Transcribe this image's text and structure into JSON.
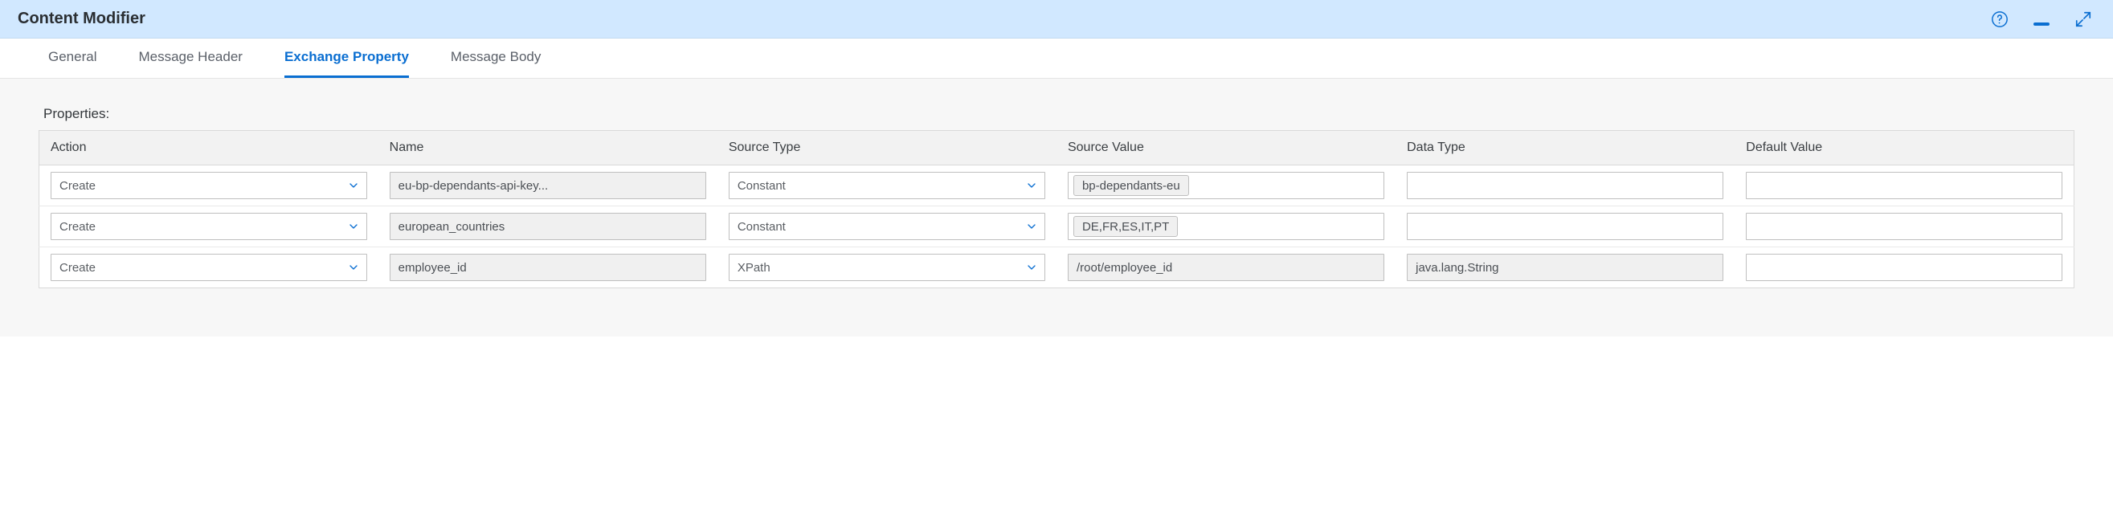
{
  "header": {
    "title": "Content Modifier"
  },
  "tabs": [
    {
      "label": "General",
      "active": false
    },
    {
      "label": "Message Header",
      "active": false
    },
    {
      "label": "Exchange Property",
      "active": true
    },
    {
      "label": "Message Body",
      "active": false
    }
  ],
  "section_label": "Properties:",
  "columns": {
    "action": "Action",
    "name": "Name",
    "source_type": "Source Type",
    "source_value": "Source Value",
    "data_type": "Data Type",
    "default_value": "Default Value"
  },
  "rows": [
    {
      "action": "Create",
      "name": "eu-bp-dependants-api-key...",
      "source_type": "Constant",
      "source_value": "bp-dependants-eu",
      "source_value_ispill": true,
      "data_type": "",
      "default_value": ""
    },
    {
      "action": "Create",
      "name": "european_countries",
      "source_type": "Constant",
      "source_value": "DE,FR,ES,IT,PT",
      "source_value_ispill": true,
      "data_type": "",
      "default_value": ""
    },
    {
      "action": "Create",
      "name": "employee_id",
      "source_type": "XPath",
      "source_value": "/root/employee_id",
      "source_value_ispill": false,
      "data_type": "java.lang.String",
      "default_value": ""
    }
  ]
}
